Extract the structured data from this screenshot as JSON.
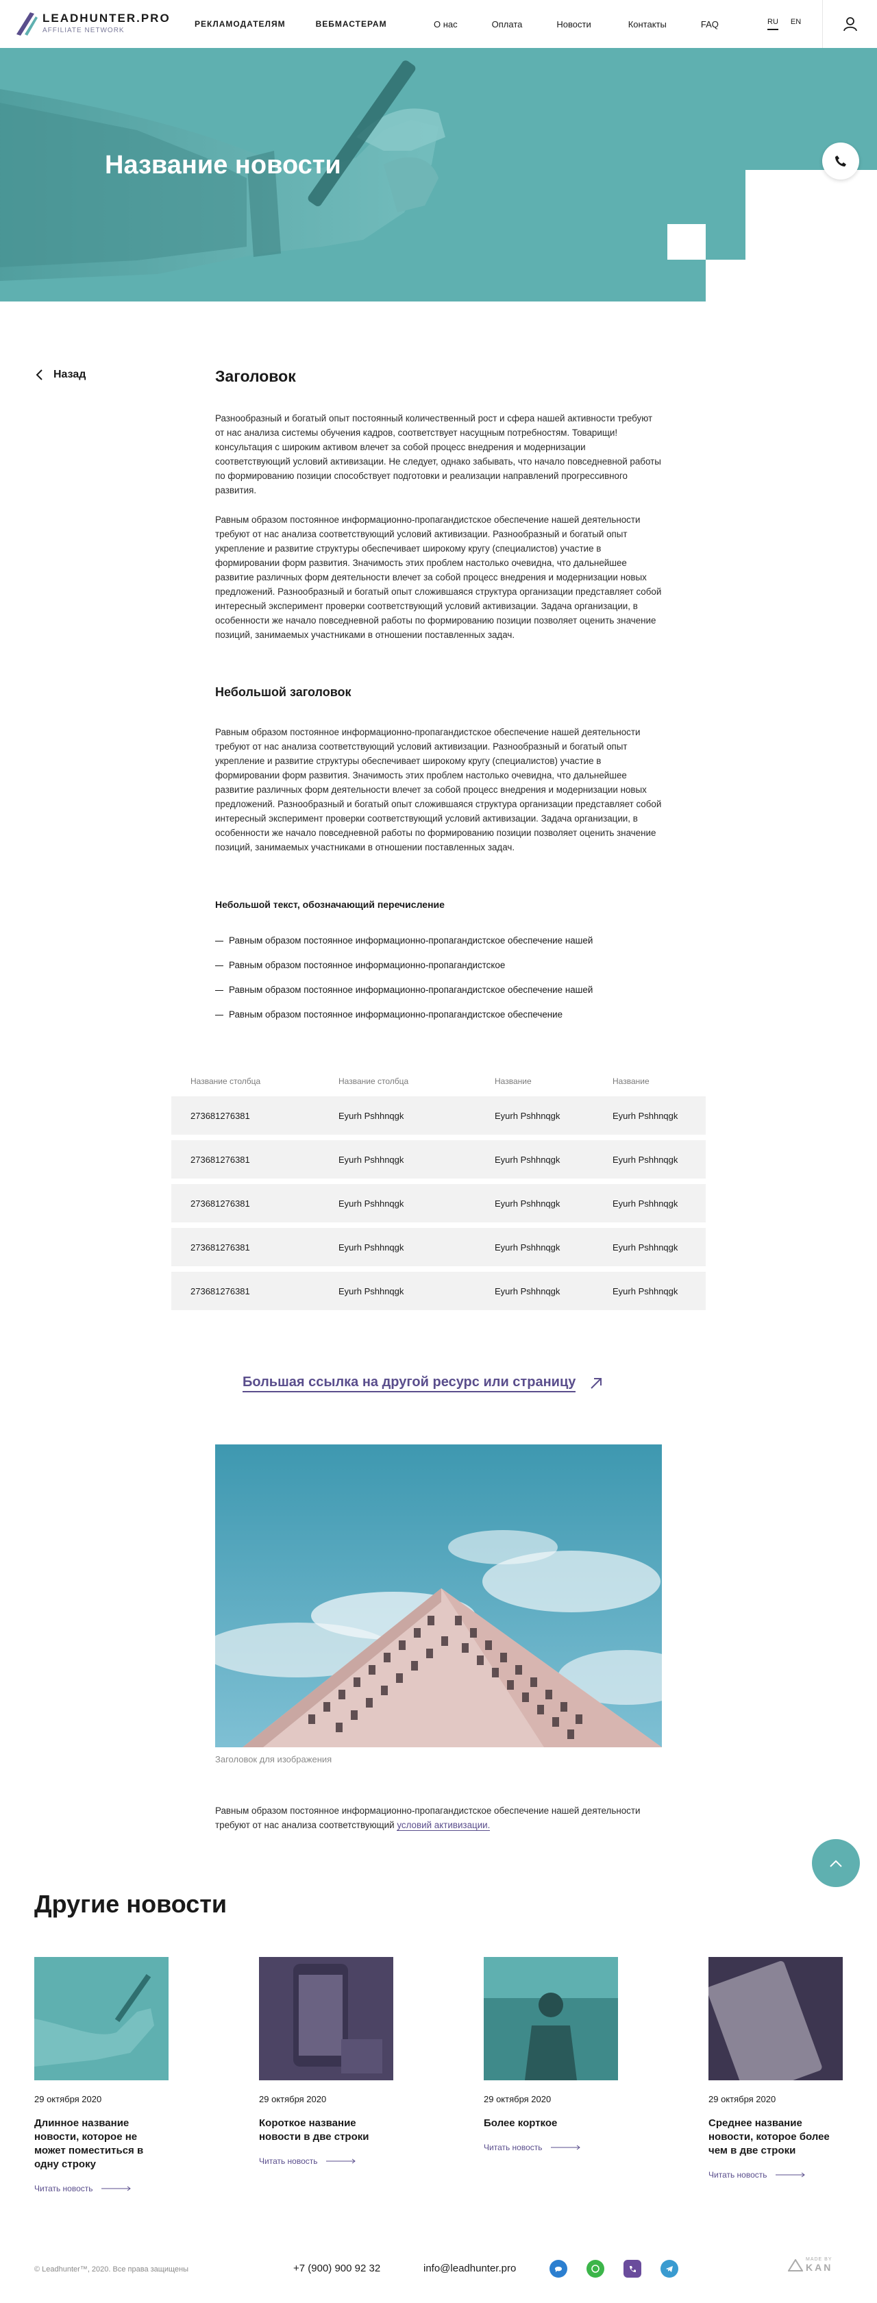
{
  "header": {
    "logo_title": "LEADHUNTER.PRO",
    "logo_sub": "AFFILIATE NETWORK",
    "nav_main": [
      "РЕКЛАМОДАТЕЛЯМ",
      "ВЕБМАСТЕРАМ"
    ],
    "nav_secondary": [
      "О нас",
      "Оплата",
      "Новости",
      "Контакты",
      "FAQ"
    ],
    "lang": [
      "RU",
      "EN"
    ],
    "lang_active": "RU"
  },
  "hero": {
    "title": "Название новости"
  },
  "back_label": "Назад",
  "article": {
    "heading": "Заголовок",
    "p1": "Разнообразный и богатый опыт постоянный количественный рост и сфера нашей активности требуют от нас анализа системы обучения кадров, соответствует насущным потребностям. Товарищи! консультация с широким активом влечет за собой процесс внедрения и модернизации соответствующий условий активизации. Не следует, однако забывать, что начало повседневной работы по формированию позиции способствует подготовки и реализации направлений прогрессивного развития.",
    "p2": "Равным образом постоянное информационно-пропагандистское обеспечение нашей деятельности требуют от нас анализа соответствующий условий активизации. Разнообразный и богатый опыт укрепление и развитие структуры обеспечивает широкому кругу (специалистов) участие в формировании форм развития. Значимость этих проблем настолько очевидна, что дальнейшее развитие различных форм деятельности влечет за собой процесс внедрения и модернизации новых предложений. Разнообразный и богатый опыт сложившаяся структура организации представляет собой интересный эксперимент проверки соответствующий условий активизации. Задача организации, в особенности же начало повседневной работы по формированию позиции позволяет оценить значение позиций, занимаемых участниками в отношении поставленных задач.",
    "subheading": "Небольшой заголовок",
    "p3": "Равным образом постоянное информационно-пропагандистское обеспечение нашей деятельности требуют от нас анализа соответствующий условий активизации. Разнообразный и богатый опыт укрепление и развитие структуры обеспечивает широкому кругу (специалистов) участие в формировании форм развития. Значимость этих проблем настолько очевидна, что дальнейшее развитие различных форм деятельности влечет за собой процесс внедрения и модернизации новых предложений. Разнообразный и богатый опыт сложившаяся структура организации представляет собой интересный эксперимент проверки соответствующий условий активизации. Задача организации, в особенности же начало повседневной работы по формированию позиции позволяет оценить значение позиций, занимаемых участниками в отношении поставленных задач.",
    "list_title": "Небольшой текст, обозначающий перечисление",
    "list": [
      "Равным образом постоянное информационно-пропагандистское обеспечение нашей",
      "Равным образом постоянное информационно-пропагандистское",
      "Равным образом постоянное информационно-пропагандистское обеспечение нашей",
      "Равным образом постоянное информационно-пропагандистское обеспечение"
    ]
  },
  "table": {
    "headers": [
      "Название столбца",
      "Название столбца",
      "Название",
      "Название"
    ],
    "rows": [
      [
        "273681276381",
        "Eyurh Pshhnqgk",
        "Eyurh Pshhnqgk",
        "Eyurh Pshhnqgk"
      ],
      [
        "273681276381",
        "Eyurh Pshhnqgk",
        "Eyurh Pshhnqgk",
        "Eyurh Pshhnqgk"
      ],
      [
        "273681276381",
        "Eyurh Pshhnqgk",
        "Eyurh Pshhnqgk",
        "Eyurh Pshhnqgk"
      ],
      [
        "273681276381",
        "Eyurh Pshhnqgk",
        "Eyurh Pshhnqgk",
        "Eyurh Pshhnqgk"
      ],
      [
        "273681276381",
        "Eyurh Pshhnqgk",
        "Eyurh Pshhnqgk",
        "Eyurh Pshhnqgk"
      ]
    ]
  },
  "big_link": "Большая ссылка на другой ресурс или страницу",
  "image_caption": "Заголовок для изображения",
  "final_text": "Равным образом постоянное информационно-пропагандистское обеспечение нашей деятельности требуют от нас анализа соответствующий",
  "final_link": "условий активизации.",
  "other_news": {
    "title": "Другие новости",
    "cards": [
      {
        "date": "29 октября 2020",
        "title": "Длинное название новости, которое не может поместиться в одну строку",
        "link": "Читать новость"
      },
      {
        "date": "29 октября 2020",
        "title": "Короткое название новости в две строки",
        "link": "Читать новость"
      },
      {
        "date": "29 октября 2020",
        "title": "Более корткое",
        "link": "Читать новость"
      },
      {
        "date": "29 октября 2020",
        "title": "Среднее название новости, которое более чем в две строки",
        "link": "Читать новость"
      }
    ]
  },
  "footer": {
    "copyright": "© Leadhunter™, 2020. Все права защищены",
    "phone": "+7 (900) 900 92 32",
    "email": "info@leadhunter.pro",
    "made_by": "MADE BY",
    "made_name": "KAN"
  },
  "colors": {
    "teal": "#5fb0b0",
    "purple": "#5a4e8c",
    "row_bg": "#f2f2f2"
  },
  "icons": [
    "logo-slash-icon",
    "user-icon",
    "phone-icon",
    "chevron-left-icon",
    "arrow-up-right-icon",
    "arrow-right-icon",
    "chevron-up-icon",
    "messenger-icon",
    "whatsapp-icon",
    "viber-icon",
    "telegram-icon"
  ]
}
